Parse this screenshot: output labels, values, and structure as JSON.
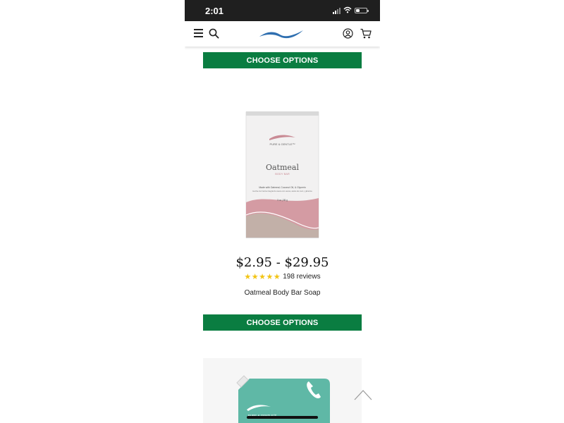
{
  "status_bar": {
    "time": "2:01"
  },
  "buttons": {
    "choose_options_top": "CHOOSE OPTIONS",
    "choose_options_bottom": "CHOOSE OPTIONS"
  },
  "product": {
    "price_range": "$2.95 - $29.95",
    "stars": "★★★★★",
    "rating": 5,
    "reviews": "198 reviews",
    "name": "Oatmeal Body Bar Soap",
    "package": {
      "brand": "PURE & GENTLE™",
      "title": "Oatmeal",
      "subtitle": "BODY BAR",
      "ingredients": "Made with Oatmeal, Coconut Oil, & Glycerin",
      "ingredients_es": "Hecha con harina integral de avena con avena, aceite de coco y glicerina",
      "weight": "3 oz | 85 g"
    }
  },
  "next_product": {
    "brand": "PURE & GENTLE™"
  },
  "colors": {
    "button_green": "#0a7d41",
    "star_yellow": "#f2c414",
    "logo_blue": "#2f6fb0",
    "pack_pink": "#d49ba3",
    "pouch_teal": "#5fb8a6"
  },
  "icons": [
    "menu-icon",
    "search-icon",
    "logo-wave",
    "account-icon",
    "cart-icon",
    "scroll-top-icon",
    "phone-icon"
  ]
}
